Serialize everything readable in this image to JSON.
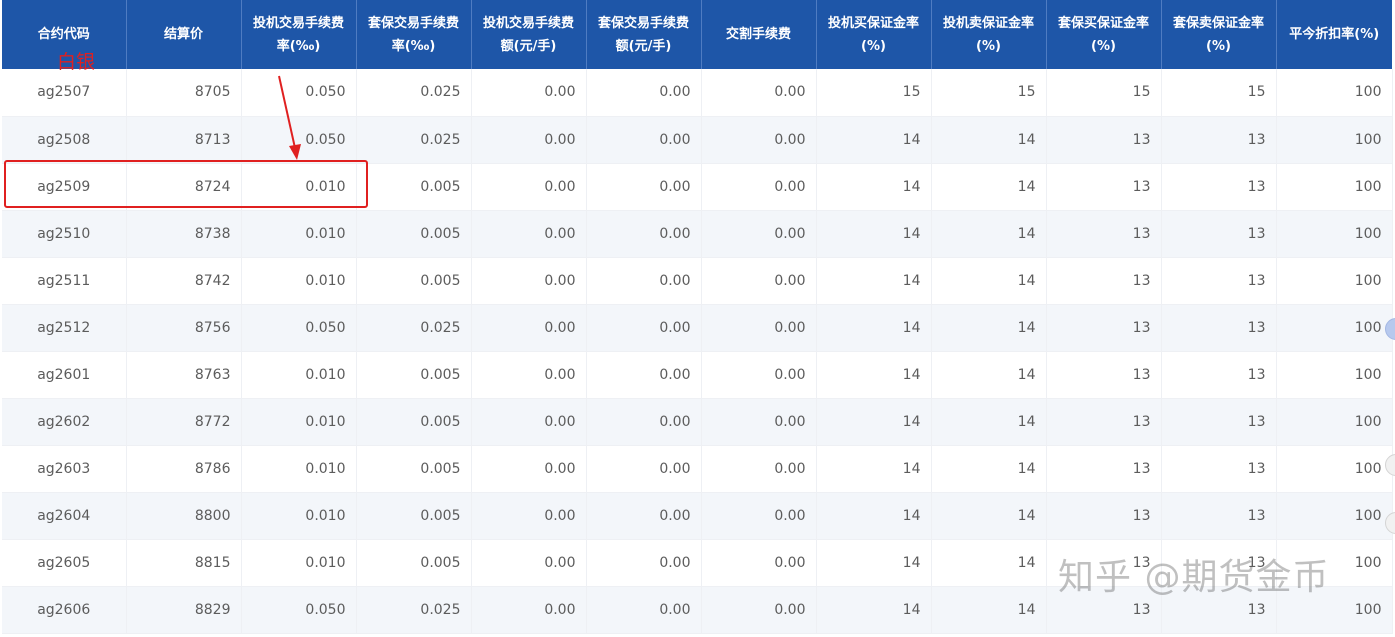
{
  "table": {
    "headers": [
      "合约代码",
      "结算价",
      "投机交易手续费率(‰)",
      "套保交易手续费率(‰)",
      "投机交易手续费额(元/手)",
      "套保交易手续费额(元/手)",
      "交割手续费",
      "投机买保证金率(%)",
      "投机卖保证金率(%)",
      "套保买保证金率(%)",
      "套保卖保证金率(%)",
      "平今折扣率(%)"
    ],
    "rows": [
      [
        "ag2507",
        "8705",
        "0.050",
        "0.025",
        "0.00",
        "0.00",
        "0.00",
        "15",
        "15",
        "15",
        "15",
        "100"
      ],
      [
        "ag2508",
        "8713",
        "0.050",
        "0.025",
        "0.00",
        "0.00",
        "0.00",
        "14",
        "14",
        "13",
        "13",
        "100"
      ],
      [
        "ag2509",
        "8724",
        "0.010",
        "0.005",
        "0.00",
        "0.00",
        "0.00",
        "14",
        "14",
        "13",
        "13",
        "100"
      ],
      [
        "ag2510",
        "8738",
        "0.010",
        "0.005",
        "0.00",
        "0.00",
        "0.00",
        "14",
        "14",
        "13",
        "13",
        "100"
      ],
      [
        "ag2511",
        "8742",
        "0.010",
        "0.005",
        "0.00",
        "0.00",
        "0.00",
        "14",
        "14",
        "13",
        "13",
        "100"
      ],
      [
        "ag2512",
        "8756",
        "0.050",
        "0.025",
        "0.00",
        "0.00",
        "0.00",
        "14",
        "14",
        "13",
        "13",
        "100"
      ],
      [
        "ag2601",
        "8763",
        "0.010",
        "0.005",
        "0.00",
        "0.00",
        "0.00",
        "14",
        "14",
        "13",
        "13",
        "100"
      ],
      [
        "ag2602",
        "8772",
        "0.010",
        "0.005",
        "0.00",
        "0.00",
        "0.00",
        "14",
        "14",
        "13",
        "13",
        "100"
      ],
      [
        "ag2603",
        "8786",
        "0.010",
        "0.005",
        "0.00",
        "0.00",
        "0.00",
        "14",
        "14",
        "13",
        "13",
        "100"
      ],
      [
        "ag2604",
        "8800",
        "0.010",
        "0.005",
        "0.00",
        "0.00",
        "0.00",
        "14",
        "14",
        "13",
        "13",
        "100"
      ],
      [
        "ag2605",
        "8815",
        "0.010",
        "0.005",
        "0.00",
        "0.00",
        "0.00",
        "14",
        "14",
        "13",
        "13",
        "100"
      ],
      [
        "ag2606",
        "8829",
        "0.050",
        "0.025",
        "0.00",
        "0.00",
        "0.00",
        "14",
        "14",
        "13",
        "13",
        "100"
      ]
    ]
  },
  "annotation": {
    "label": "白银",
    "color": "#e02020"
  },
  "watermark": {
    "text": "知乎 @期货金币"
  },
  "colors": {
    "header_bg": "#1e56a8",
    "header_text": "#ffffff",
    "row_alt_bg": "#f3f6fa",
    "cell_text": "#5c5c5c"
  }
}
